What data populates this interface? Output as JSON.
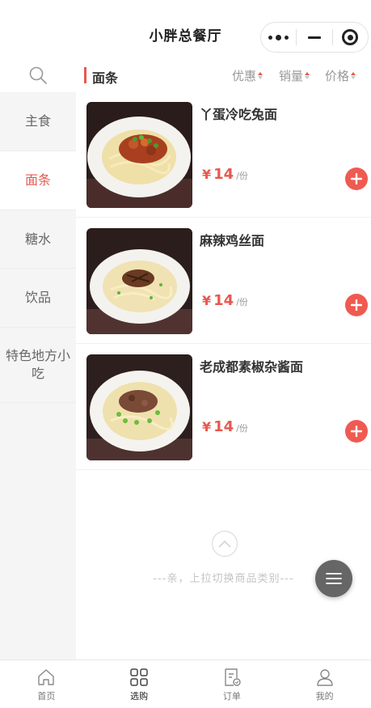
{
  "header": {
    "title": "小胖总餐厅"
  },
  "sidebar": {
    "search_icon": "search-icon",
    "items": [
      {
        "label": "主食",
        "active": false
      },
      {
        "label": "面条",
        "active": true
      },
      {
        "label": "糖水",
        "active": false
      },
      {
        "label": "饮品",
        "active": false
      },
      {
        "label": "特色地方小吃",
        "active": false
      }
    ]
  },
  "category": {
    "name": "面条",
    "sorts": [
      "优惠",
      "销量",
      "价格"
    ]
  },
  "products": [
    {
      "name": "丫蛋冷吃兔面",
      "currency": "¥",
      "price": "14",
      "unit": "/份"
    },
    {
      "name": "麻辣鸡丝面",
      "currency": "¥",
      "price": "14",
      "unit": "/份"
    },
    {
      "name": "老成都素椒杂酱面",
      "currency": "¥",
      "price": "14",
      "unit": "/份"
    }
  ],
  "footer_hint": "---亲，上拉切换商品类别---",
  "tabbar": [
    {
      "label": "首页",
      "icon": "home-icon",
      "active": false
    },
    {
      "label": "选购",
      "icon": "grid-icon",
      "active": true
    },
    {
      "label": "订单",
      "icon": "order-icon",
      "active": false
    },
    {
      "label": "我的",
      "icon": "user-icon",
      "active": false
    }
  ],
  "colors": {
    "accent": "#e8584f",
    "sidebar_bg": "#f5f5f5"
  }
}
